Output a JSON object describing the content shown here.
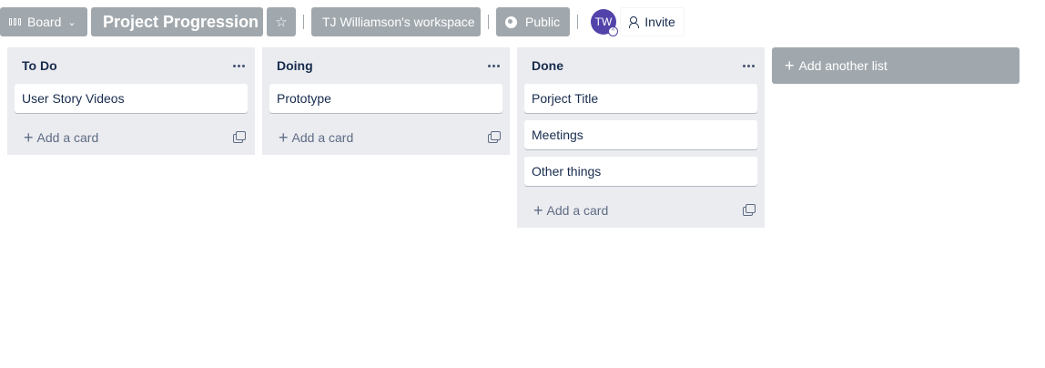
{
  "header": {
    "board_switch_label": "Board",
    "board_title": "Project Progression",
    "star_icon": "☆",
    "workspace_label": "TJ Williamson's workspace",
    "visibility_label": "Public",
    "avatar_initials": "TW",
    "invite_label": "Invite"
  },
  "lists": [
    {
      "title": "To Do",
      "cards": [
        "User Story Videos"
      ],
      "add_card_label": "Add a card"
    },
    {
      "title": "Doing",
      "cards": [
        "Prototype"
      ],
      "add_card_label": "Add a card"
    },
    {
      "title": "Done",
      "cards": [
        "Porject Title",
        "Meetings",
        "Other things"
      ],
      "add_card_label": "Add a card"
    }
  ],
  "add_list_label": "Add another list",
  "colors": {
    "header_button_bg": "#a1a8ad",
    "list_bg": "#ebecf0",
    "avatar_bg": "#5243aa"
  }
}
